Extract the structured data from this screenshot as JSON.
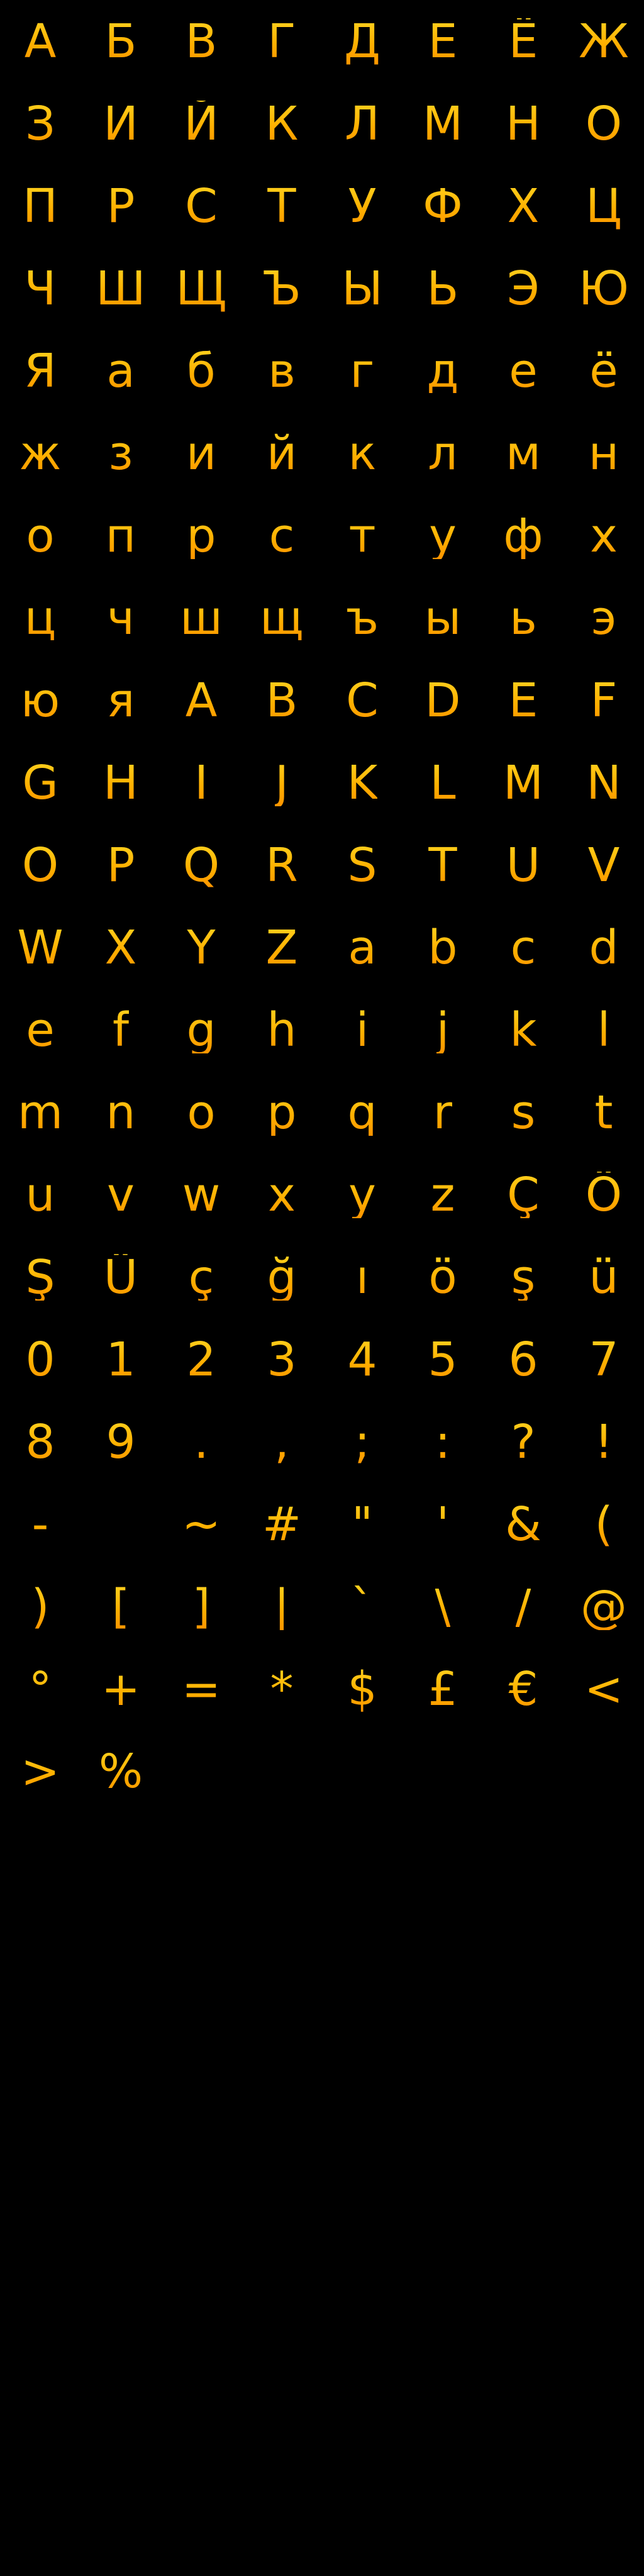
{
  "sheet": {
    "background": "#000000",
    "glyph_color_top": "#ffd21f",
    "glyph_color_bottom": "#ff9500",
    "rows": [
      [
        "А",
        "Б",
        "В",
        "Г",
        "Д",
        "Е",
        "Ё",
        "Ж"
      ],
      [
        "З",
        "И",
        "Й",
        "К",
        "Л",
        "М",
        "Н",
        "О"
      ],
      [
        "П",
        "Р",
        "С",
        "Т",
        "У",
        "Ф",
        "Х",
        "Ц"
      ],
      [
        "Ч",
        "Ш",
        "Щ",
        "Ъ",
        "Ы",
        "Ь",
        "Э",
        "Ю"
      ],
      [
        "Я",
        "а",
        "б",
        "в",
        "г",
        "д",
        "е",
        "ё"
      ],
      [
        "ж",
        "з",
        "и",
        "й",
        "к",
        "л",
        "м",
        "н"
      ],
      [
        "о",
        "п",
        "р",
        "с",
        "т",
        "у",
        "ф",
        "х"
      ],
      [
        "ц",
        "ч",
        "ш",
        "щ",
        "ъ",
        "ы",
        "ь",
        "э"
      ],
      [
        "ю",
        "я",
        "A",
        "B",
        "C",
        "D",
        "E",
        "F"
      ],
      [
        "G",
        "H",
        "I",
        "J",
        "K",
        "L",
        "M",
        "N"
      ],
      [
        "O",
        "P",
        "Q",
        "R",
        "S",
        "T",
        "U",
        "V"
      ],
      [
        "W",
        "X",
        "Y",
        "Z",
        "a",
        "b",
        "c",
        "d"
      ],
      [
        "e",
        "f",
        "g",
        "h",
        "i",
        "j",
        "k",
        "l"
      ],
      [
        "m",
        "n",
        "o",
        "p",
        "q",
        "r",
        "s",
        "t"
      ],
      [
        "u",
        "v",
        "w",
        "x",
        "y",
        "z",
        "Ç",
        "Ö"
      ],
      [
        "Ş",
        "Ü",
        "ç",
        "ğ",
        "ı",
        "ö",
        "ş",
        "ü"
      ],
      [
        "0",
        "1",
        "2",
        "3",
        "4",
        "5",
        "6",
        "7"
      ],
      [
        "8",
        "9",
        ".",
        ",",
        ";",
        ":",
        "?",
        "!"
      ],
      [
        "-",
        "_",
        "~",
        "#",
        "\"",
        "'",
        "&",
        "("
      ],
      [
        ")",
        "[",
        "]",
        "|",
        "`",
        "\\",
        "/",
        "@"
      ],
      [
        "°",
        "+",
        "=",
        "*",
        "$",
        "£",
        "€",
        "<"
      ],
      [
        ">",
        "%"
      ]
    ]
  }
}
